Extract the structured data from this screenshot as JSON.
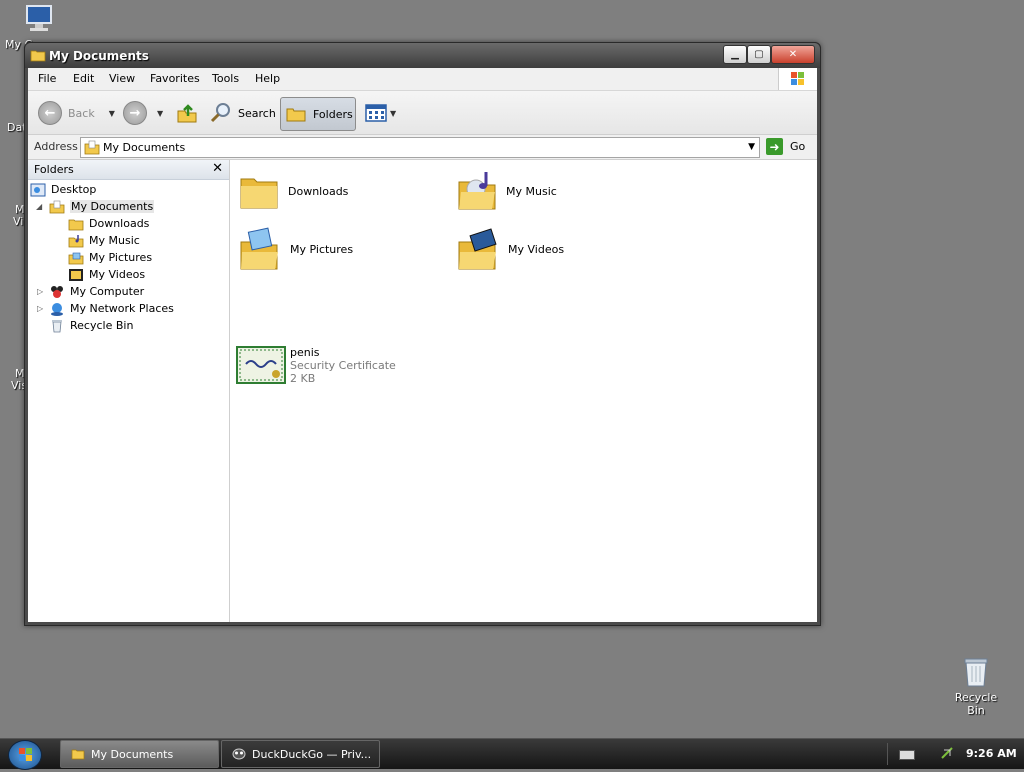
{
  "desktop": {
    "partial_labels": [
      "My C",
      "Dat",
      "M",
      "Vi",
      "M",
      "Vis"
    ],
    "recycle_bin_label": "Recycle Bin"
  },
  "window": {
    "title": "My Documents",
    "menu": [
      "File",
      "Edit",
      "View",
      "Favorites",
      "Tools",
      "Help"
    ],
    "toolbar": {
      "back_label": "Back",
      "search_label": "Search",
      "folders_label": "Folders"
    },
    "address": {
      "label": "Address",
      "value": "My Documents",
      "go_label": "Go"
    },
    "folders_pane": {
      "title": "Folders",
      "close_glyph": "✕",
      "tree": [
        {
          "label": "Desktop",
          "icon": "desktop-icon"
        },
        {
          "label": "My Documents",
          "icon": "my-documents-icon",
          "expanded": true
        },
        {
          "label": "Downloads",
          "icon": "folder-icon"
        },
        {
          "label": "My Music",
          "icon": "music-folder-icon"
        },
        {
          "label": "My Pictures",
          "icon": "pictures-folder-icon"
        },
        {
          "label": "My Videos",
          "icon": "videos-folder-icon"
        },
        {
          "label": "My Computer",
          "icon": "computer-icon"
        },
        {
          "label": "My Network Places",
          "icon": "network-icon"
        },
        {
          "label": "Recycle Bin",
          "icon": "recycle-bin-icon"
        }
      ]
    },
    "files": [
      {
        "name": "Downloads",
        "icon": "folder-icon"
      },
      {
        "name": "My Music",
        "icon": "music-folder-icon"
      },
      {
        "name": "My Pictures",
        "icon": "pictures-folder-icon"
      },
      {
        "name": "My Videos",
        "icon": "videos-folder-icon"
      },
      {
        "name": "penis",
        "type": "Security Certificate",
        "size": "2 KB",
        "icon": "certificate-icon"
      }
    ]
  },
  "taskbar": {
    "tasks": [
      {
        "label": "My Documents",
        "active": true
      },
      {
        "label": "DuckDuckGo — Priv...",
        "active": false
      }
    ],
    "clock": "9:26 AM"
  },
  "colors": {
    "desktop_bg": "#7f7f7f",
    "folder_yellow": "#f2c94c"
  }
}
